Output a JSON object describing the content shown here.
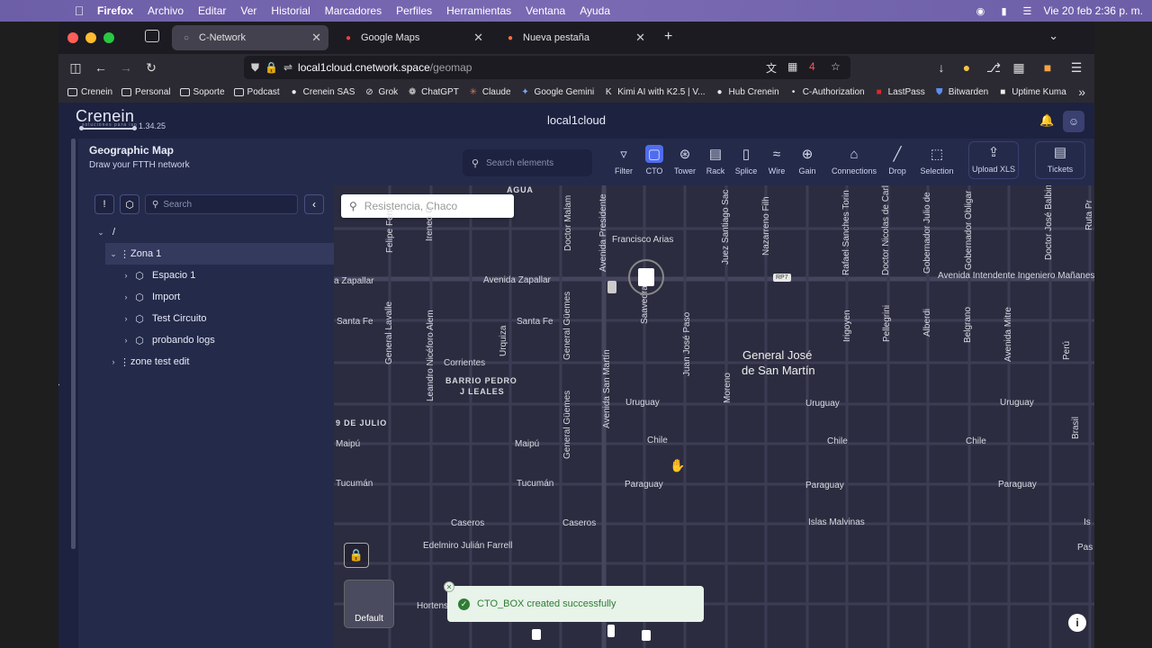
{
  "menubar": {
    "app": "Firefox",
    "items": [
      "Archivo",
      "Editar",
      "Ver",
      "Historial",
      "Marcadores",
      "Perfiles",
      "Herramientas",
      "Ventana",
      "Ayuda"
    ],
    "clock": "Vie 20 feb  2:36 p. m."
  },
  "tabs": [
    {
      "label": "C-Network",
      "active": true
    },
    {
      "label": "Google Maps",
      "active": false
    },
    {
      "label": "Nueva pestaña",
      "active": false
    }
  ],
  "url": {
    "host": "local1cloud.cnetwork.space",
    "path": "/geomap"
  },
  "bookmarks": [
    "Crenein",
    "Personal",
    "Soporte",
    "Podcast",
    "Crenein SAS",
    "Grok",
    "ChatGPT",
    "Claude",
    "Google Gemini",
    "Kimi AI with K2.5 | V...",
    "Hub Crenein",
    "C-Authorization",
    "LastPass",
    "Bitwarden",
    "Uptime Kuma"
  ],
  "app": {
    "logo": "Crenein",
    "logo_sub": "soluciones para isp",
    "version": "1.34.25",
    "title": "local1cloud"
  },
  "page": {
    "title": "Geographic Map",
    "subtitle": "Draw your FTTH network"
  },
  "toolbar": {
    "search_placeholder": "Search elements",
    "tools": [
      "Filter",
      "CTO",
      "Tower",
      "Rack",
      "Splice",
      "Wire",
      "Gain",
      "Connections",
      "Drop",
      "Selection",
      "Upload XLS",
      "Tickets"
    ],
    "active_tool": "CTO"
  },
  "sidebar": {
    "search_placeholder": "Search",
    "root": "/",
    "items": [
      {
        "label": "Zona 1",
        "level": 0,
        "expanded": true,
        "selected": true
      },
      {
        "label": "Espacio 1",
        "level": 1
      },
      {
        "label": "Import",
        "level": 1
      },
      {
        "label": "Test Circuito",
        "level": 1
      },
      {
        "label": "probando logs",
        "level": 1
      },
      {
        "label": "zone test edit",
        "level": 0
      }
    ]
  },
  "map": {
    "search_placeholder": "Resistencia, Chaco",
    "route_badge": "RP7",
    "layer_label": "Default",
    "labels_h": [
      "Francisco Arias",
      "Avenida Zapallar",
      "a Zapallar",
      "Avenida Intendente Ingeniero Mañanes",
      "Santa Fe",
      "Santa Fe",
      "Corrientes",
      "Uruguay",
      "Uruguay",
      "Uruguay",
      "Maipú",
      "Maipú",
      "Chile",
      "Chile",
      "Chile",
      "Tucumán",
      "Tucumán",
      "Paraguay",
      "Paraguay",
      "Paraguay",
      "Caseros",
      "Caseros",
      "Islas Malvinas",
      "Edelmiro Julián Farrell",
      "Hortens",
      "Pas",
      "Is"
    ],
    "labels_caps": [
      "AGUA",
      "BARRIO PEDRO",
      "J LEALES",
      "9 DE JULIO"
    ],
    "labels_big": [
      "General José",
      "de San Martín"
    ],
    "labels_v": [
      "Felipe Ferr",
      "Ireneo G",
      "Doctor Malam",
      "Avenida Presidente",
      "Juez Santiago Sac",
      "Nazarreno Filh",
      "Rafael Sanches Torin",
      "Doctor Nicolas de Carlo",
      "Gobernador Julio de",
      "Gobernador Obligar",
      "Doctor José Balbin",
      "Ruta Pr",
      "General Lavalle",
      "Leandro Nicéforo Alem",
      "Urquiza",
      "General Güemes",
      "Saavedra",
      "Juan José Paso",
      "Irigoyen",
      "Pellegrini",
      "Alberdi",
      "Belgrano",
      "Avenida Mitre",
      "Perú",
      "Moreno",
      "Avenida San Martín",
      "General Güemes",
      "Brasil"
    ],
    "toast": "CTO_BOX created successfully"
  }
}
